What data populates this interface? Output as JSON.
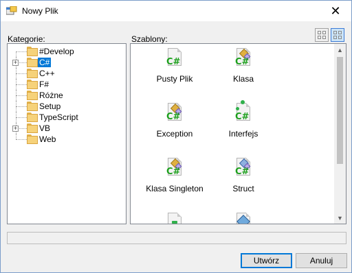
{
  "window": {
    "title": "Nowy Plik",
    "close_symbol": "✕"
  },
  "labels": {
    "categories": "Kategorie:",
    "templates": "Szablony:"
  },
  "view_buttons": [
    {
      "icon": "large-icons-view-icon",
      "selected": false
    },
    {
      "icon": "small-icons-view-icon",
      "selected": true
    }
  ],
  "categories": [
    {
      "label": "#Develop",
      "expandable": false,
      "selected": false
    },
    {
      "label": "C#",
      "expandable": true,
      "selected": true
    },
    {
      "label": "C++",
      "expandable": false,
      "selected": false
    },
    {
      "label": "F#",
      "expandable": false,
      "selected": false
    },
    {
      "label": "Różne",
      "expandable": false,
      "selected": false
    },
    {
      "label": "Setup",
      "expandable": false,
      "selected": false
    },
    {
      "label": "TypeScript",
      "expandable": false,
      "selected": false
    },
    {
      "label": "VB",
      "expandable": true,
      "selected": false
    },
    {
      "label": "Web",
      "expandable": false,
      "selected": false
    }
  ],
  "templates": [
    {
      "label": "Pusty Plik",
      "icon": "csharp-file-icon"
    },
    {
      "label": "Klasa",
      "icon": "csharp-class-icon"
    },
    {
      "label": "Exception",
      "icon": "csharp-class-icon"
    },
    {
      "label": "Interfejs",
      "icon": "csharp-interface-icon"
    },
    {
      "label": "Klasa Singleton",
      "icon": "csharp-class-icon"
    },
    {
      "label": "Struct",
      "icon": "csharp-struct-icon"
    },
    {
      "label": "",
      "icon": "csharp-partial-icon"
    },
    {
      "label": "",
      "icon": "csharp-web-icon"
    }
  ],
  "buttons": {
    "create": "Utwórz",
    "cancel": "Anuluj"
  },
  "colors": {
    "selection": "#0078d7",
    "csharp_green": "#1c9f1c"
  }
}
